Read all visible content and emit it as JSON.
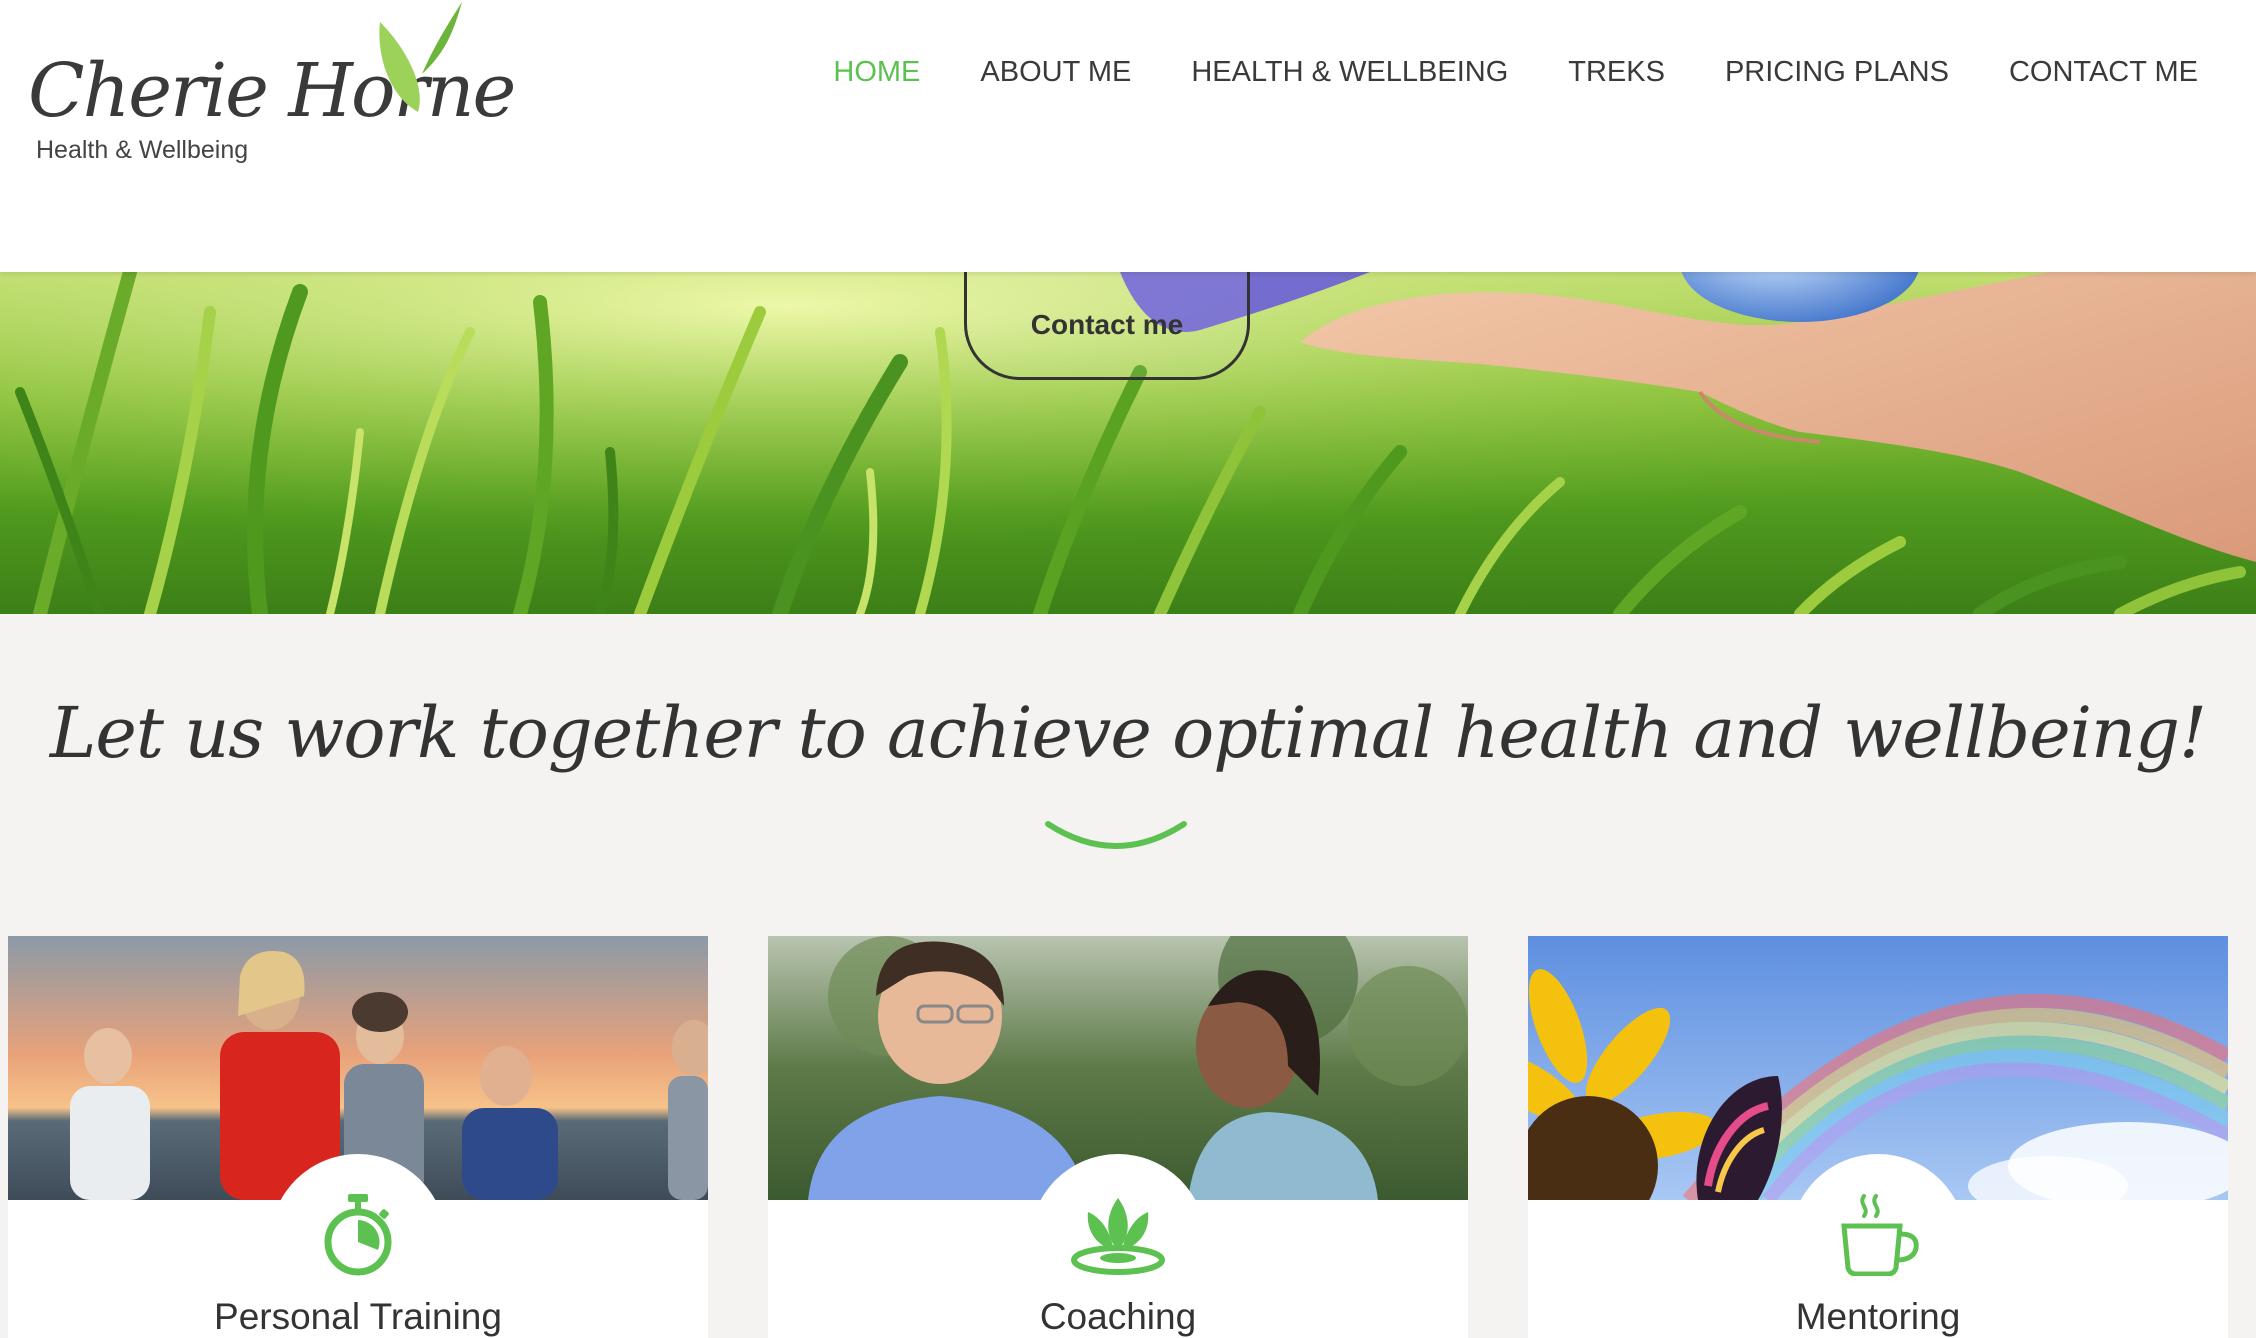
{
  "brand": {
    "name": "Cherie Horne",
    "tagline": "Health & Wellbeing"
  },
  "nav": {
    "items": [
      {
        "label": "HOME",
        "active": true
      },
      {
        "label": "ABOUT ME",
        "active": false
      },
      {
        "label": "HEALTH & WELLBEING",
        "active": false
      },
      {
        "label": "TREKS",
        "active": false
      },
      {
        "label": "PRICING PLANS",
        "active": false
      },
      {
        "label": "CONTACT ME",
        "active": false
      }
    ]
  },
  "hero": {
    "cta_label": "Contact me"
  },
  "main": {
    "heading": "Let us work together to achieve optimal health and wellbeing!"
  },
  "cards": [
    {
      "title": "Personal Training",
      "icon": "stopwatch-icon"
    },
    {
      "title": "Coaching",
      "icon": "lotus-icon"
    },
    {
      "title": "Mentoring",
      "icon": "coffee-cup-icon"
    }
  ],
  "colors": {
    "accent": "#5cc150",
    "text": "#333333",
    "background": "#f4f3f1"
  }
}
